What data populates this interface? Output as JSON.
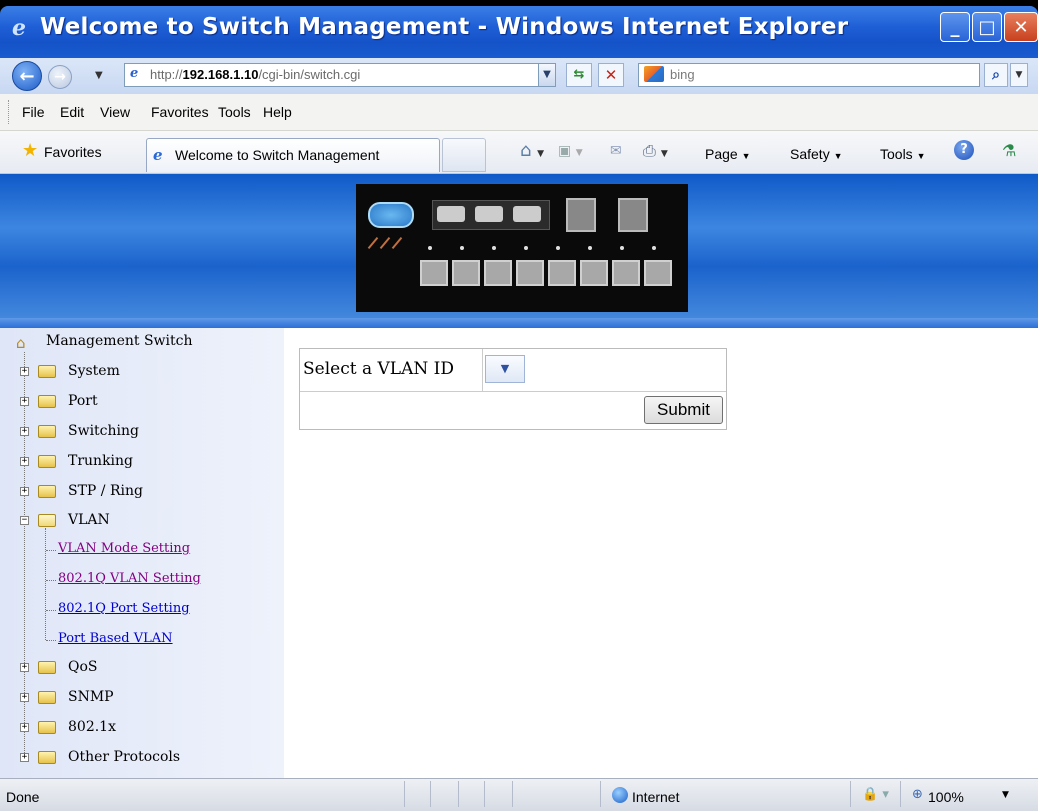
{
  "window": {
    "title": "Welcome to Switch Management - Windows Internet Explorer"
  },
  "address_bar": {
    "url_prefix": "http://",
    "url_host": "192.168.1.10",
    "url_path": "/cgi-bin/switch.cgi",
    "search_placeholder": "bing"
  },
  "menu": {
    "file": "File",
    "edit": "Edit",
    "view": "View",
    "favorites": "Favorites",
    "tools": "Tools",
    "help": "Help"
  },
  "favorites_bar": {
    "favorites_label": "Favorites",
    "tab_title": "Welcome to Switch Management",
    "page_label": "Page",
    "safety_label": "Safety",
    "tools_label": "Tools"
  },
  "sidebar": {
    "root": "Management Switch",
    "items_before": [
      "System",
      "Port",
      "Switching",
      "Trunking",
      "STP / Ring"
    ],
    "vlan": {
      "label": "VLAN",
      "children": [
        {
          "label": "VLAN Mode Setting",
          "visited": true
        },
        {
          "label": "802.1Q VLAN Setting",
          "visited": true
        },
        {
          "label": "802.1Q Port Setting",
          "visited": false
        },
        {
          "label": "Port Based VLAN",
          "visited": false
        }
      ]
    },
    "items_after": [
      "QoS",
      "SNMP",
      "802.1x",
      "Other Protocols"
    ]
  },
  "form": {
    "vlan_label": "Select a VLAN ID",
    "vlan_selected": "",
    "submit_label": "Submit"
  },
  "status_bar": {
    "status": "Done",
    "zone": "Internet",
    "zoom": "100%"
  },
  "icons": {
    "title": "ie-logo-icon",
    "back": "back-arrow-icon",
    "forward": "forward-arrow-icon",
    "refresh": "refresh-icon",
    "stop": "stop-icon",
    "search": "search-icon",
    "home": "home-icon",
    "feeds": "feeds-icon",
    "mail": "mail-icon",
    "print": "print-icon",
    "help": "help-icon",
    "research": "research-icon"
  },
  "colors": {
    "titlebar": "#1f5fd6",
    "banner": "#1b63cc",
    "sidebar_bg": "#e6ecf8",
    "link_visited": "#800080",
    "link_unvisited": "#0000cc"
  }
}
